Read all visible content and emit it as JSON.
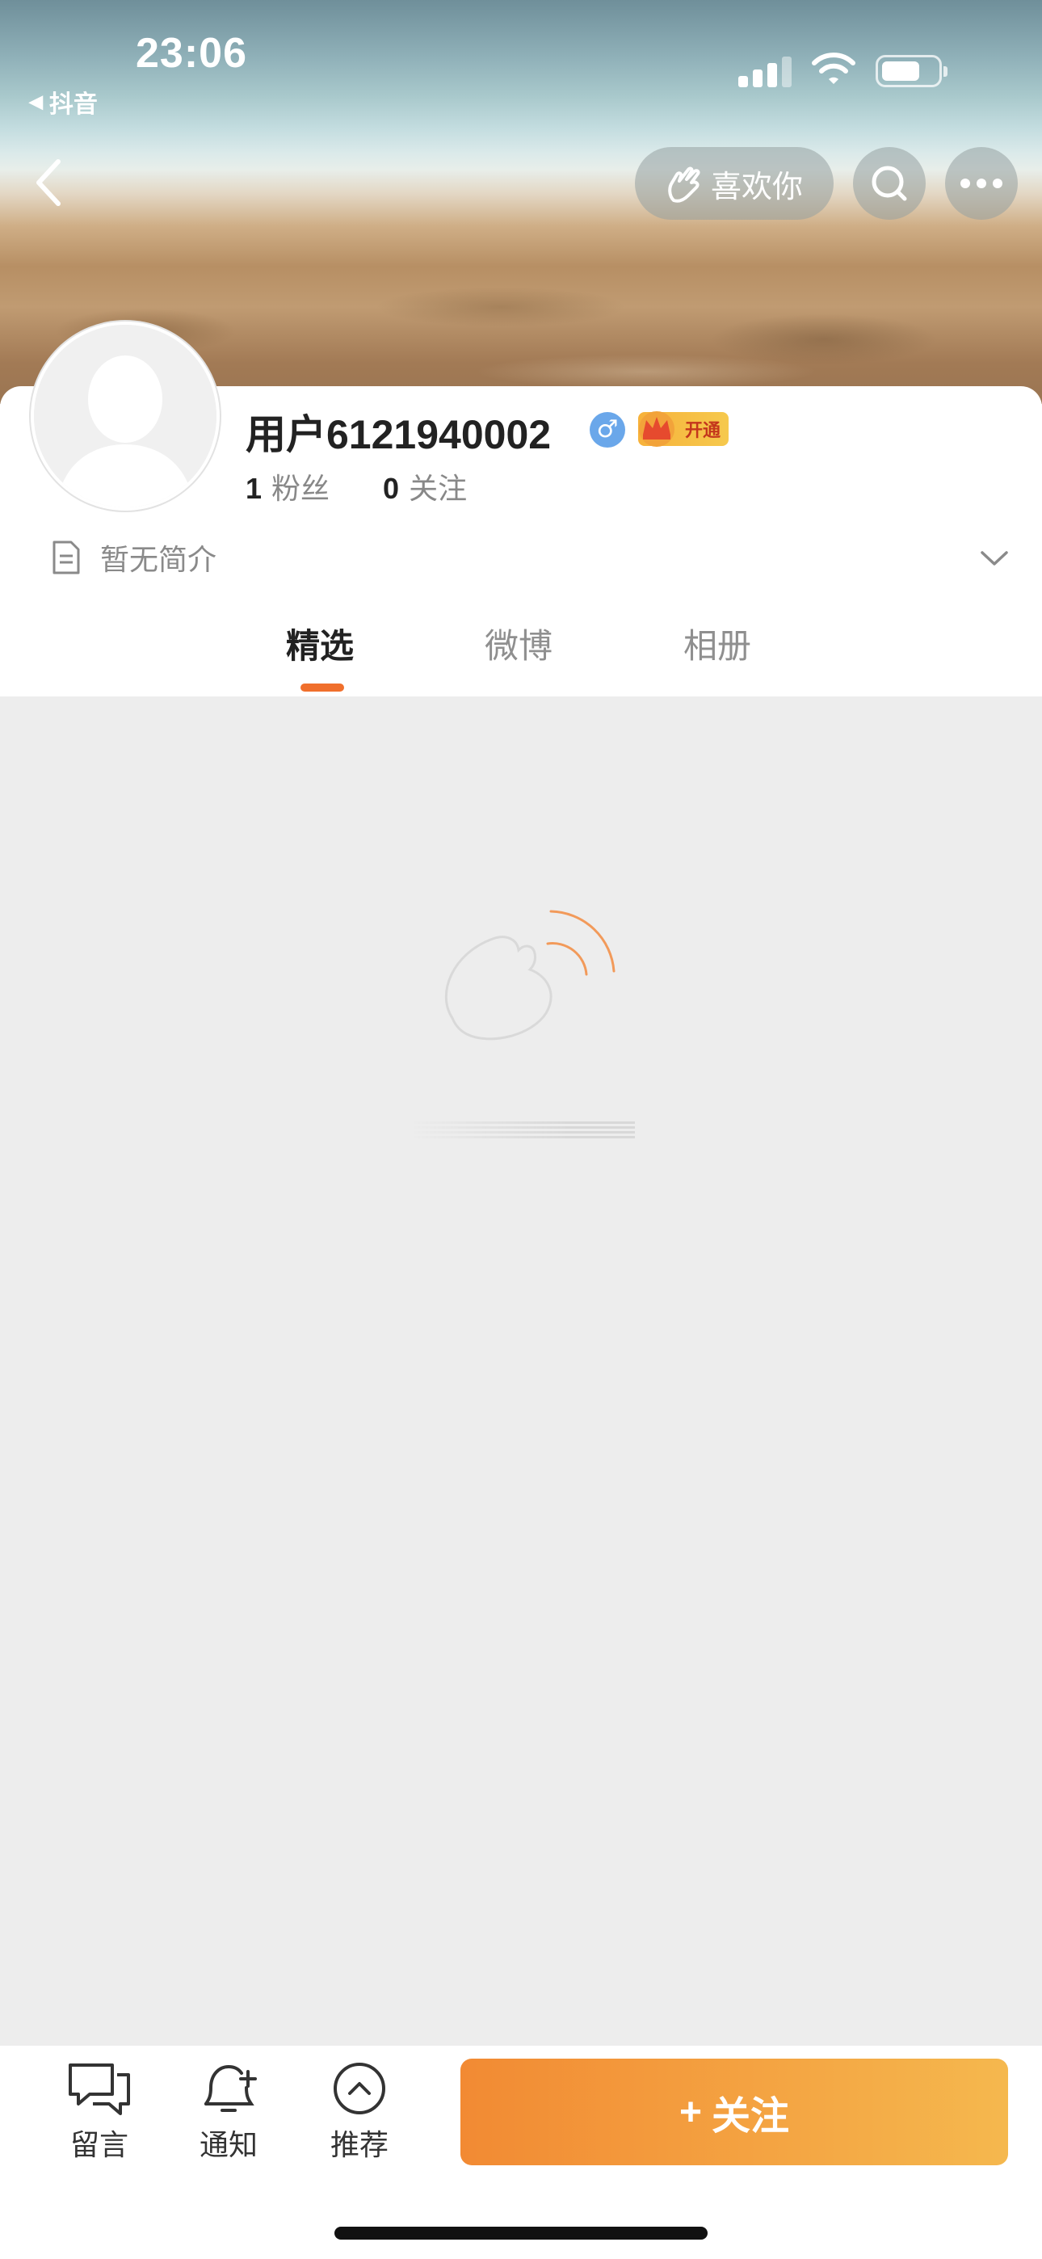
{
  "status_bar": {
    "time": "23:06",
    "back_app_label": "抖音"
  },
  "nav": {
    "like_label": "喜欢你",
    "icons": [
      "back-chevron-icon",
      "hand-heart-icon",
      "search-icon",
      "more-icon"
    ]
  },
  "profile": {
    "username": "用户6121940002",
    "gender_symbol": "♂",
    "vip_label": "开通",
    "followers_count": "1",
    "followers_label": "粉丝",
    "following_count": "0",
    "following_label": "关注",
    "bio": "暂无简介"
  },
  "tabs": [
    {
      "label": "精选",
      "active": true
    },
    {
      "label": "微博",
      "active": false
    },
    {
      "label": "相册",
      "active": false
    }
  ],
  "bottom_bar": {
    "message_label": "留言",
    "notify_label": "通知",
    "recommend_label": "推荐",
    "follow_label": "关注",
    "follow_plus": "+"
  },
  "colors": {
    "accent": "#f06f2c",
    "follow_gradient_start": "#f28a33",
    "follow_gradient_end": "#f5b84e",
    "gender_badge": "#6aa7ea",
    "content_background": "#ededed"
  }
}
